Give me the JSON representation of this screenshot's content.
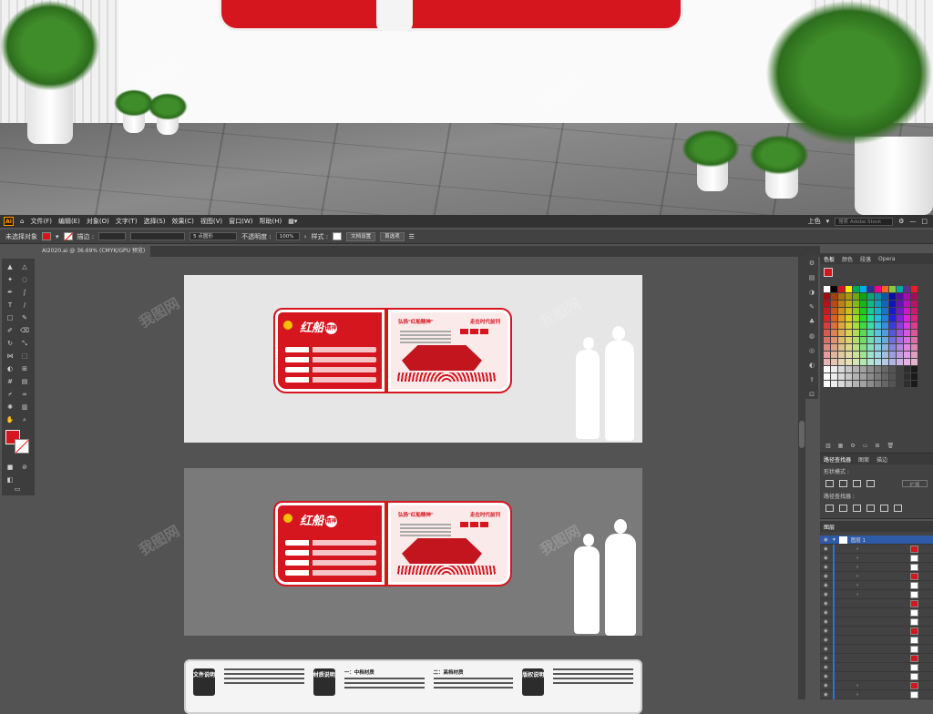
{
  "menubar": {
    "items": [
      "文件(F)",
      "编辑(E)",
      "对象(O)",
      "文字(T)",
      "选择(S)",
      "效果(C)",
      "视图(V)",
      "窗口(W)",
      "帮助(H)"
    ],
    "right_label": "上色",
    "search_placeholder": "搜索 Adobe Stock"
  },
  "control_bar": {
    "selection_status": "未选择对象",
    "stroke_label": "描边 :",
    "brush_value": "5 点圆形",
    "opacity_label": "不透明度 :",
    "opacity_value": "100%",
    "style_label": "样式 :",
    "doc_setup_button": "文档设置",
    "prefs_button": "首选项"
  },
  "document_tab": {
    "label": "AI2020.ai @ 36.69% (CMYK/GPU 预览)"
  },
  "panels": {
    "color": {
      "tabs": [
        "色板",
        "颜色",
        "段落",
        "Opera"
      ]
    },
    "pathfinder": {
      "tabs": [
        "路径查找器",
        "图案",
        "描边"
      ],
      "shape_modes_label": "形状模式 :",
      "expand_button": "扩展",
      "pathfinder_label": "路径查找器 :"
    },
    "layers": {
      "tab": "图层",
      "top_layer": "图层 1"
    }
  },
  "artboard": {
    "board_title": "红船",
    "board_title_badge": "精神",
    "right_heading_left": "弘扬\"红船精神\"",
    "right_heading_right": "走在时代前列",
    "doc_labels": [
      "文件说明",
      "材质说明",
      "版权说明"
    ],
    "doc_col_heads": [
      "一：中档材质",
      "二：高档材质"
    ]
  },
  "watermark": "我图网",
  "colors": {
    "brand_red": "#d6161f",
    "panel_bg": "#424242",
    "canvas_bg": "#535353",
    "selection_blue": "#2e5aa8"
  }
}
